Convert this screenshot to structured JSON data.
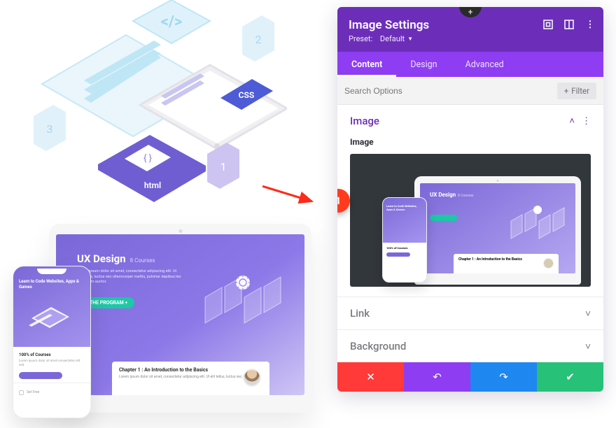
{
  "panel": {
    "title": "Image Settings",
    "preset_label": "Preset:",
    "preset_value": "Default",
    "tabs": {
      "content": "Content",
      "design": "Design",
      "advanced": "Advanced"
    },
    "search_placeholder": "Search Options",
    "filter_label": "Filter",
    "sections": {
      "image": {
        "title": "Image",
        "field_label": "Image"
      },
      "link": {
        "title": "Link"
      },
      "background": {
        "title": "Background"
      }
    },
    "annotation_badge": "1"
  },
  "mockup": {
    "ux_title": "UX Design",
    "ux_subtitle": "8 Courses",
    "ux_copy": "Lorem ipsum dolor sit amet, consectetur adipiscing elit. Ut elit tellus, luctus nec ullamcorper mattis, pulvinar dapibus leo bibendum auctor.",
    "ux_cta": "★  THE PROGRAM  +",
    "chapter_title": "Chapter 1 : An Introduction to the Basics",
    "chapter_copy": "Lorem ipsum dolor sit amet, consectetur adipiscing elit. Ut elit tellus, luctus nec.",
    "phone_header": "Learn to Code Websites, Apps & Games",
    "phone_section": "100% of Courses",
    "phone_section_copy": "Lorem ipsum dolor sit amet consectetur elit sed.",
    "check_label": "Set Free"
  },
  "iso": {
    "code_tag": "</>",
    "css_tag": "CSS",
    "braces_tag": "{ }",
    "html_tag": "html",
    "card1": "1",
    "card2": "2",
    "card3": "3"
  }
}
